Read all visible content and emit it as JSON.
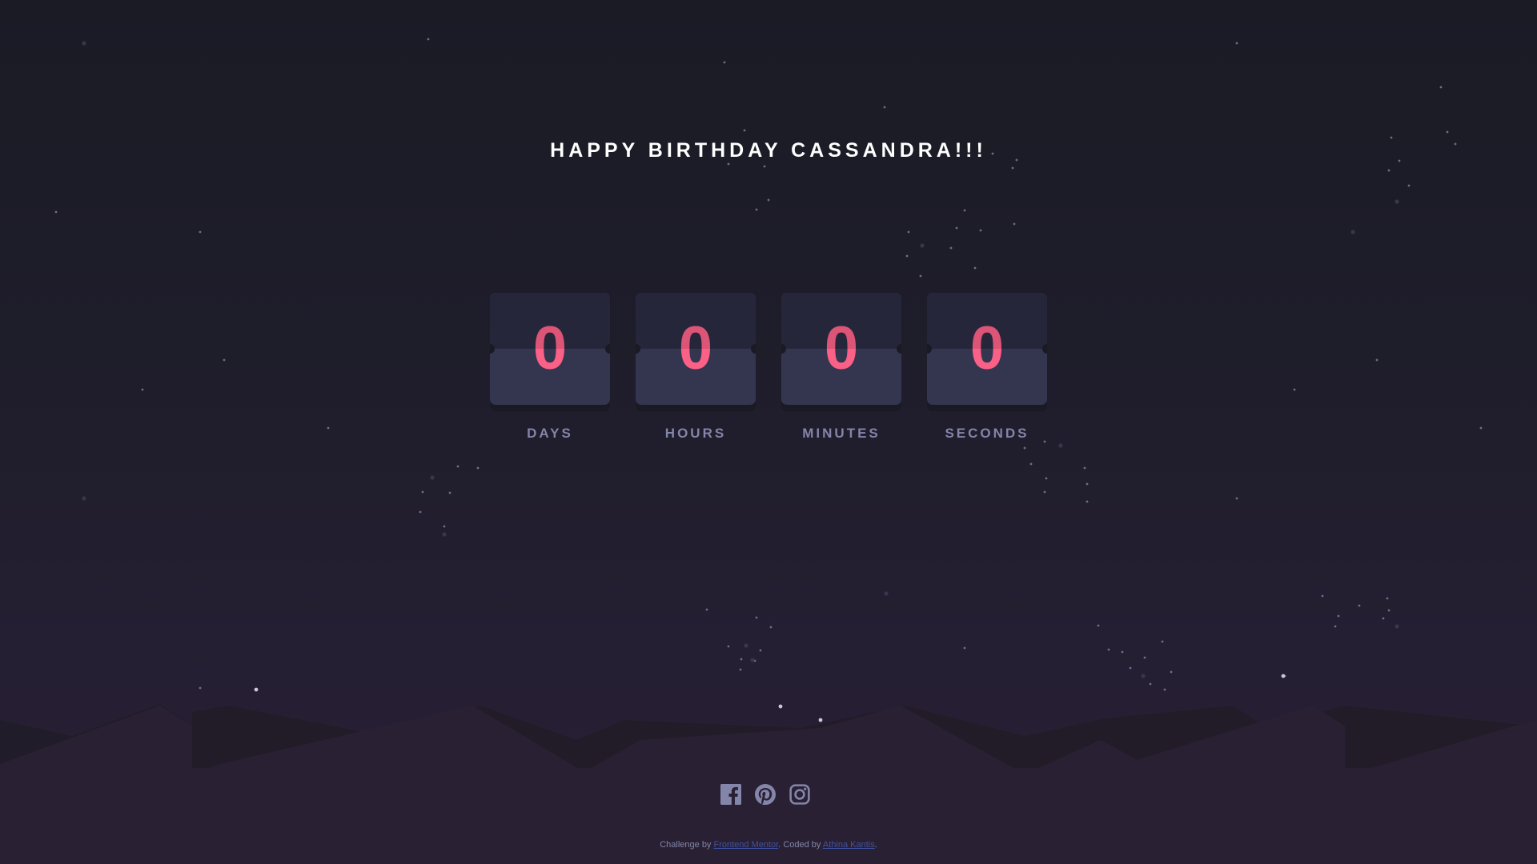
{
  "title": "HAPPY BIRTHDAY CASSANDRA!!!",
  "countdown": [
    {
      "value": "0",
      "label": "DAYS"
    },
    {
      "value": "0",
      "label": "HOURS"
    },
    {
      "value": "0",
      "label": "MINUTES"
    },
    {
      "value": "0",
      "label": "SECONDS"
    }
  ],
  "socials": [
    {
      "name": "facebook-icon"
    },
    {
      "name": "pinterest-icon"
    },
    {
      "name": "instagram-icon"
    }
  ],
  "attribution": {
    "prefix": "Challenge by ",
    "challenge_link": "Frontend Mentor",
    "middle": ". Coded by ",
    "author_link": "Athina Kantis",
    "suffix": "."
  },
  "colors": {
    "accent": "#fb6087",
    "label": "#8385a9",
    "card_top": "#2c2c44",
    "card_bottom": "#343650",
    "link": "#3e52a3"
  }
}
